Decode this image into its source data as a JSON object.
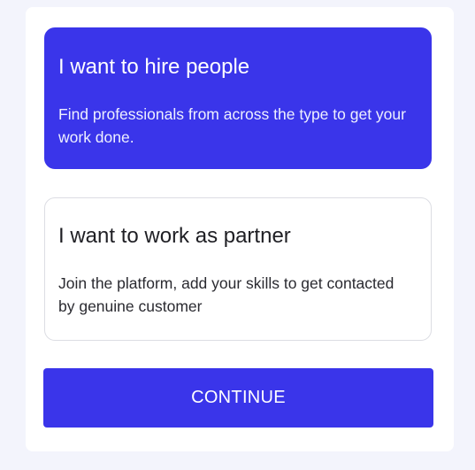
{
  "options": [
    {
      "title": "I want to hire people",
      "description": "Find professionals from across the type to get your work done.",
      "selected": true
    },
    {
      "title": "I want to work as partner",
      "description": "Join the platform, add your skills to get contacted by genuine customer",
      "selected": false
    }
  ],
  "continue_label": "CONTINUE",
  "colors": {
    "accent": "#3a35ea",
    "page_background": "#f3f4fc",
    "panel_background": "#ffffff",
    "card_border": "#dcdde3"
  }
}
